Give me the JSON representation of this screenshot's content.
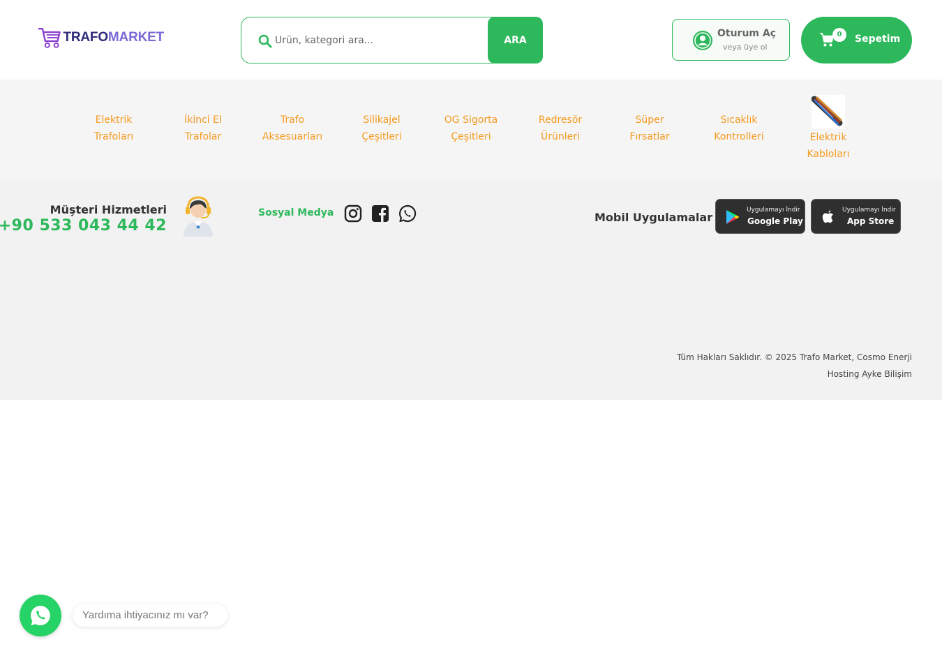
{
  "header": {
    "logo": {
      "part1": "TRAFO",
      "part2": "MARKET"
    },
    "search": {
      "placeholder": "Ürün, kategori ara...",
      "button_label": "ARA"
    },
    "login": {
      "title": "Oturum Aç",
      "subtitle": "veya üye ol"
    },
    "cart": {
      "count": "0",
      "label": "Sepetim"
    }
  },
  "categories": [
    {
      "label": "Elektrik\nTrafoları"
    },
    {
      "label": "İkinci El\nTrafolar"
    },
    {
      "label": "Trafo\nAksesuarları"
    },
    {
      "label": "Silikajel\nÇeşitleri"
    },
    {
      "label": "OG Sigorta\nÇeşitleri"
    },
    {
      "label": "Redresör\nÜrünleri"
    },
    {
      "label": "Süper\nFırsatlar"
    },
    {
      "label": "Sıcaklık\nKontrolleri"
    },
    {
      "label": "Elektrik\nKabloları"
    }
  ],
  "footer": {
    "customer_service": {
      "title": "Müşteri Hizmetleri",
      "phone": "+90 533 043 44 42"
    },
    "social_title": "Sosyal Medya",
    "social_icons": [
      "instagram-icon",
      "facebook-icon",
      "whatsapp-icon"
    ],
    "apps_title": "Mobil Uygulamalar",
    "google_play": {
      "small": "Uygulamayı İndir",
      "big": "Google Play"
    },
    "app_store": {
      "small": "Uygulamayı İndir",
      "big": "App Store"
    },
    "copyright": "Tüm Hakları Saklıdır. © 2025 Trafo Market, Cosmo Enerji",
    "hosting": "Hosting Ayke Bilişim"
  },
  "whatsapp_widget": {
    "bubble_text": "Yardıma ihtiyacınız mı var?"
  },
  "colors": {
    "accent_green": "#2eb85c",
    "category_orange": "#f59a1e",
    "logo_dark": "#2d2a7a",
    "logo_purple": "#7b68d6"
  }
}
